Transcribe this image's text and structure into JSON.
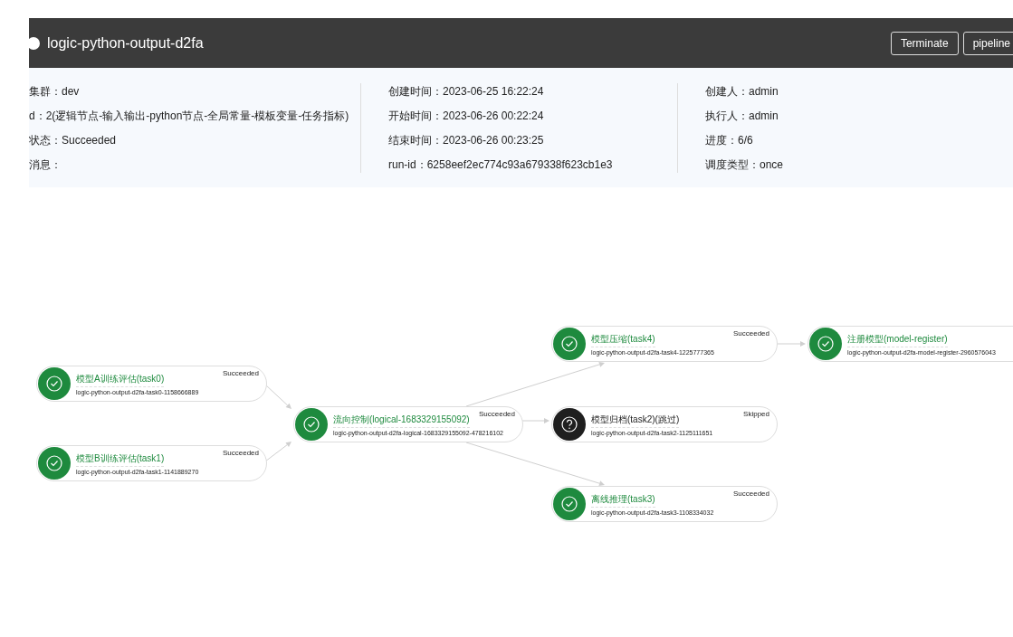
{
  "header": {
    "title": "logic-python-output-d2fa",
    "buttons": [
      "Terminate",
      "pipeline"
    ]
  },
  "info": {
    "columns": [
      [
        "集群：dev",
        "d：2(逻辑节点-输入输出-python节点-全局常量-模板变量-任务指标)",
        "状态：Succeeded",
        "消息："
      ],
      [
        "创建时间：2023-06-25 16:22:24",
        "开始时间：2023-06-26 00:22:24",
        "结束时间：2023-06-26 00:23:25",
        "run-id：6258eef2ec774c93a679338f623cb1e3"
      ],
      [
        "创建人：admin",
        "执行人：admin",
        "进度：6/6",
        "调度类型：once"
      ]
    ]
  },
  "nodes": [
    {
      "title": "模型A训练评估(task0)",
      "name": "logic-python-output-d2fa-task0-1158666889",
      "status": "Succeeded",
      "kind": "succeeded"
    },
    {
      "title": "模型B训练评估(task1)",
      "name": "logic-python-output-d2fa-task1-1141889270",
      "status": "Succeeded",
      "kind": "succeeded"
    },
    {
      "title": "流向控制(logical-1683329155092)",
      "name": "logic-python-output-d2fa-logical-1683329155092-478216102",
      "status": "Succeeded",
      "kind": "succeeded"
    },
    {
      "title": "模型压缩(task4)",
      "name": "logic-python-output-d2fa-task4-1225777365",
      "status": "Succeeded",
      "kind": "succeeded"
    },
    {
      "title": "模型归档(task2)(跳过)",
      "name": "logic-python-output-d2fa-task2-1125111651",
      "status": "Skipped",
      "kind": "skipped"
    },
    {
      "title": "离线推理(task3)",
      "name": "logic-python-output-d2fa-task3-1108334032",
      "status": "Succeeded",
      "kind": "succeeded"
    },
    {
      "title": "注册模型(model-register)",
      "name": "logic-python-output-d2fa-model-register-2960576043",
      "kind": "succeeded"
    }
  ]
}
